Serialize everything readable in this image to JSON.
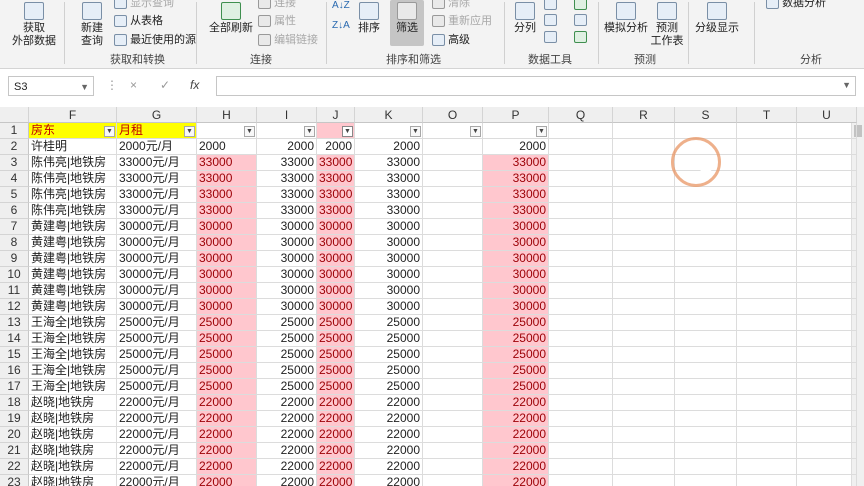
{
  "ribbon": {
    "get_external": "获取\n外部数据",
    "new_query": "新建\n查询",
    "show_query": "显示查询",
    "from_table": "从表格",
    "recent_sources": "最近使用的源",
    "group_get_transform": "获取和转换",
    "refresh_all": "全部刷新",
    "connections": "连接",
    "properties": "属性",
    "edit_links": "编辑链接",
    "group_connections": "连接",
    "sort": "排序",
    "filter": "筛选",
    "clear": "清除",
    "reapply": "重新应用",
    "advanced": "高级",
    "group_sort_filter": "排序和筛选",
    "split_columns": "分列",
    "group_data_tools": "数据工具",
    "what_if": "模拟分析",
    "forecast_sheet": "预测\n工作表",
    "group_forecast": "预测",
    "outline": "分级显示",
    "data_analysis": "数据分析",
    "group_analysis": "分析"
  },
  "formula_bar": {
    "name_box": "S3",
    "fx": "fx",
    "cancel": "×",
    "enter": "✓",
    "formula": ""
  },
  "columns": [
    "F",
    "G",
    "H",
    "I",
    "J",
    "K",
    "O",
    "P",
    "Q",
    "R",
    "S",
    "T",
    "U"
  ],
  "header_row": {
    "F": "房东",
    "G": "月租"
  },
  "rows": [
    {
      "n": "2",
      "F": "许桂明",
      "G": "2000元/月",
      "H": "2000",
      "I": "2000",
      "J": "2000",
      "K": "2000",
      "P": "2000"
    },
    {
      "n": "3",
      "F": "陈伟亮|地铁房",
      "G": "33000元/月",
      "H": "33000",
      "I": "33000",
      "J": "33000",
      "K": "33000",
      "P": "33000"
    },
    {
      "n": "4",
      "F": "陈伟亮|地铁房",
      "G": "33000元/月",
      "H": "33000",
      "I": "33000",
      "J": "33000",
      "K": "33000",
      "P": "33000"
    },
    {
      "n": "5",
      "F": "陈伟亮|地铁房",
      "G": "33000元/月",
      "H": "33000",
      "I": "33000",
      "J": "33000",
      "K": "33000",
      "P": "33000"
    },
    {
      "n": "6",
      "F": "陈伟亮|地铁房",
      "G": "33000元/月",
      "H": "33000",
      "I": "33000",
      "J": "33000",
      "K": "33000",
      "P": "33000"
    },
    {
      "n": "7",
      "F": "黄建粤|地铁房",
      "G": "30000元/月",
      "H": "30000",
      "I": "30000",
      "J": "30000",
      "K": "30000",
      "P": "30000"
    },
    {
      "n": "8",
      "F": "黄建粤|地铁房",
      "G": "30000元/月",
      "H": "30000",
      "I": "30000",
      "J": "30000",
      "K": "30000",
      "P": "30000"
    },
    {
      "n": "9",
      "F": "黄建粤|地铁房",
      "G": "30000元/月",
      "H": "30000",
      "I": "30000",
      "J": "30000",
      "K": "30000",
      "P": "30000"
    },
    {
      "n": "10",
      "F": "黄建粤|地铁房",
      "G": "30000元/月",
      "H": "30000",
      "I": "30000",
      "J": "30000",
      "K": "30000",
      "P": "30000"
    },
    {
      "n": "11",
      "F": "黄建粤|地铁房",
      "G": "30000元/月",
      "H": "30000",
      "I": "30000",
      "J": "30000",
      "K": "30000",
      "P": "30000"
    },
    {
      "n": "12",
      "F": "黄建粤|地铁房",
      "G": "30000元/月",
      "H": "30000",
      "I": "30000",
      "J": "30000",
      "K": "30000",
      "P": "30000"
    },
    {
      "n": "13",
      "F": "王海全|地铁房",
      "G": "25000元/月",
      "H": "25000",
      "I": "25000",
      "J": "25000",
      "K": "25000",
      "P": "25000"
    },
    {
      "n": "14",
      "F": "王海全|地铁房",
      "G": "25000元/月",
      "H": "25000",
      "I": "25000",
      "J": "25000",
      "K": "25000",
      "P": "25000"
    },
    {
      "n": "15",
      "F": "王海全|地铁房",
      "G": "25000元/月",
      "H": "25000",
      "I": "25000",
      "J": "25000",
      "K": "25000",
      "P": "25000"
    },
    {
      "n": "16",
      "F": "王海全|地铁房",
      "G": "25000元/月",
      "H": "25000",
      "I": "25000",
      "J": "25000",
      "K": "25000",
      "P": "25000"
    },
    {
      "n": "17",
      "F": "王海全|地铁房",
      "G": "25000元/月",
      "H": "25000",
      "I": "25000",
      "J": "25000",
      "K": "25000",
      "P": "25000"
    },
    {
      "n": "18",
      "F": "赵晓|地铁房",
      "G": "22000元/月",
      "H": "22000",
      "I": "22000",
      "J": "22000",
      "K": "22000",
      "P": "22000"
    },
    {
      "n": "19",
      "F": "赵晓|地铁房",
      "G": "22000元/月",
      "H": "22000",
      "I": "22000",
      "J": "22000",
      "K": "22000",
      "P": "22000"
    },
    {
      "n": "20",
      "F": "赵晓|地铁房",
      "G": "22000元/月",
      "H": "22000",
      "I": "22000",
      "J": "22000",
      "K": "22000",
      "P": "22000"
    },
    {
      "n": "21",
      "F": "赵晓|地铁房",
      "G": "22000元/月",
      "H": "22000",
      "I": "22000",
      "J": "22000",
      "K": "22000",
      "P": "22000"
    },
    {
      "n": "22",
      "F": "赵晓|地铁房",
      "G": "22000元/月",
      "H": "22000",
      "I": "22000",
      "J": "22000",
      "K": "22000",
      "P": "22000"
    },
    {
      "n": "23",
      "F": "赵晓|地铁房",
      "G": "22000元/月",
      "H": "22000",
      "I": "22000",
      "J": "22000",
      "K": "22000",
      "P": "22000"
    }
  ],
  "row1_label": "1",
  "colors": {
    "highlight_fill": "#ffc7ce",
    "highlight_text": "#9c0006",
    "header_fill": "#ffff00",
    "header_text": "#c00000"
  }
}
